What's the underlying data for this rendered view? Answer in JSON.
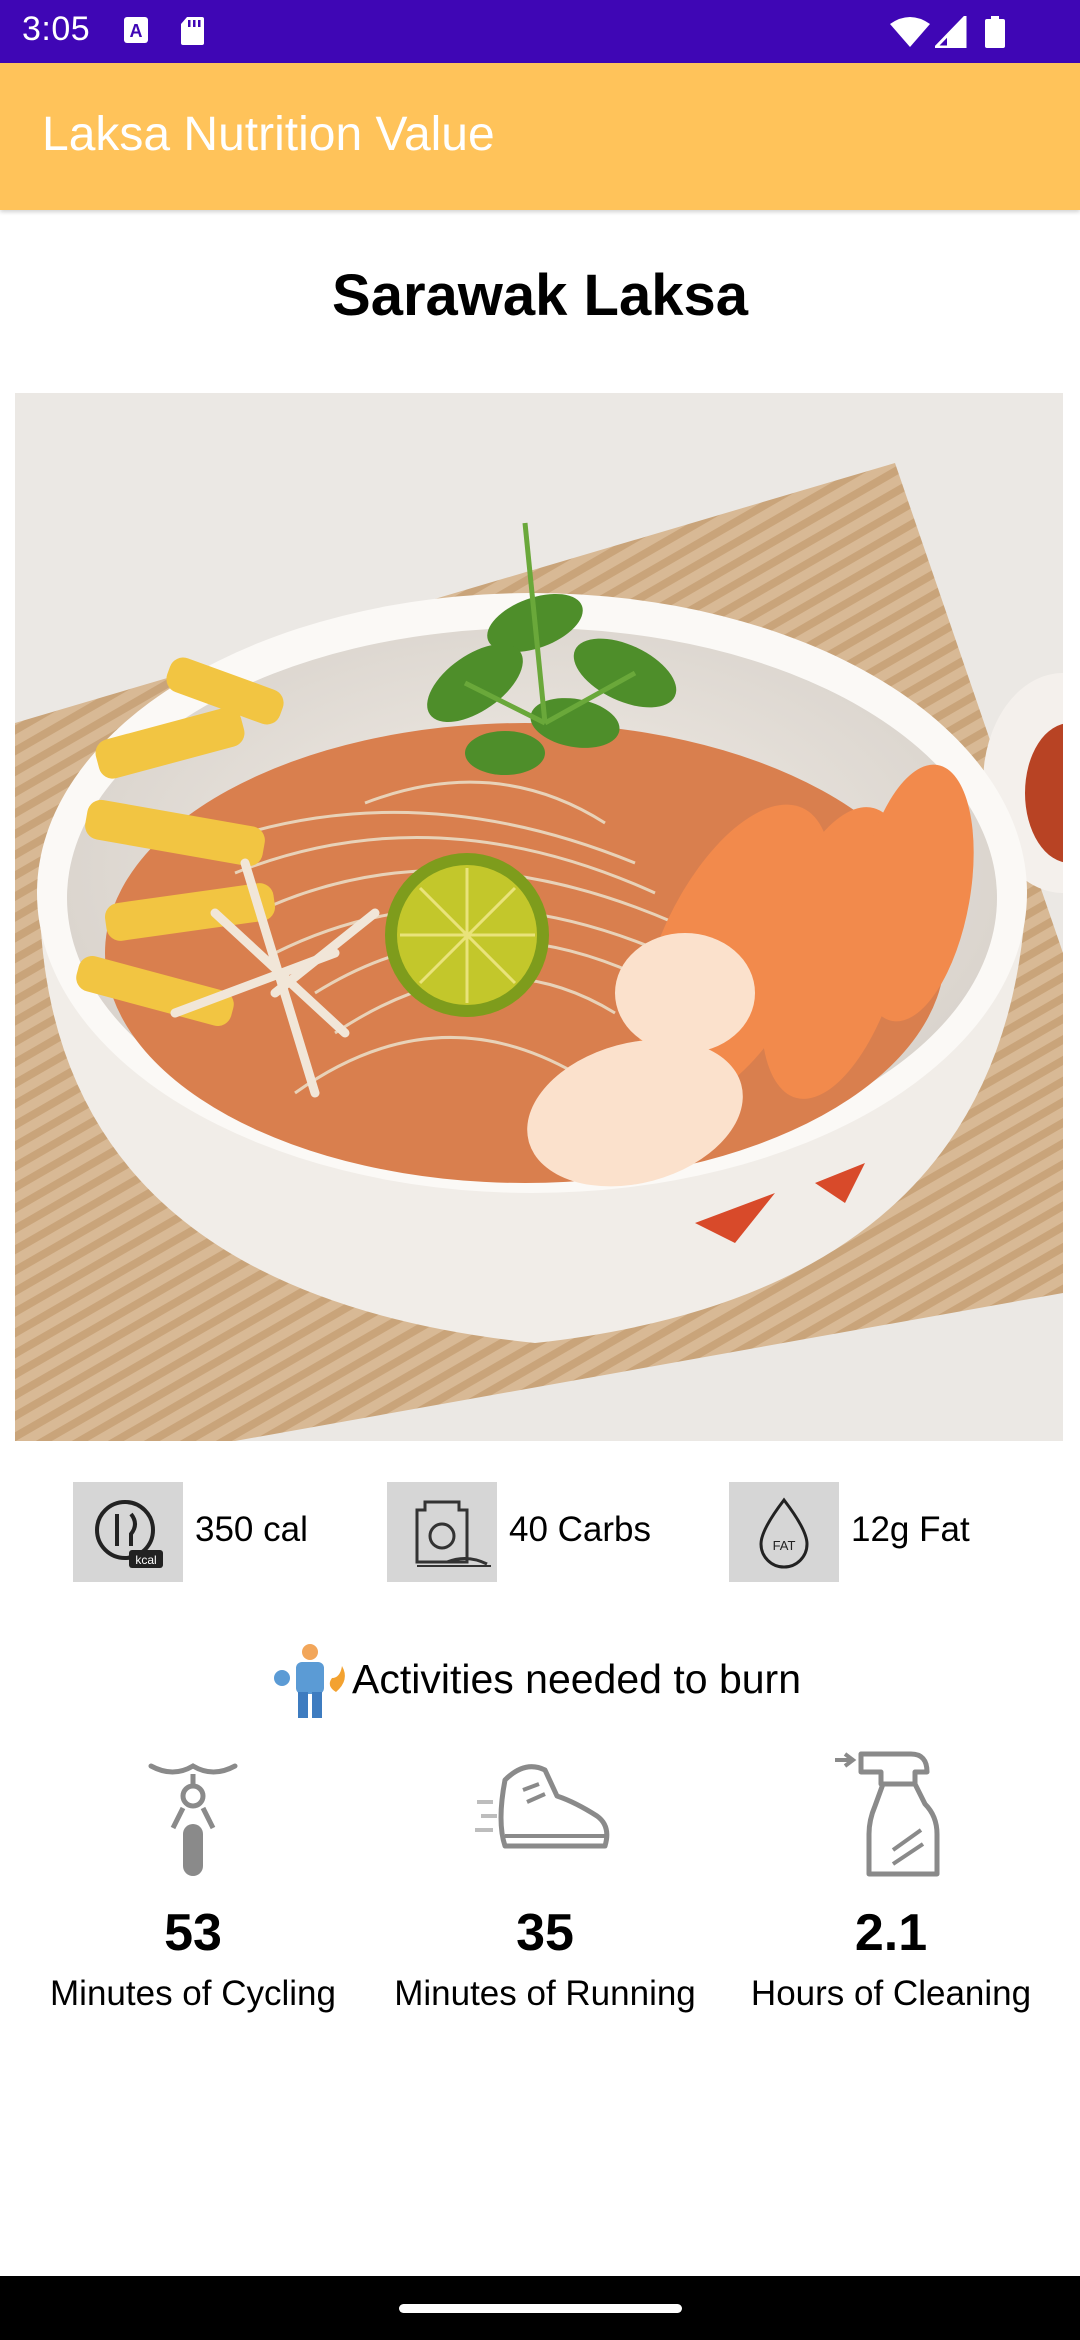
{
  "status_bar": {
    "time": "3:05",
    "left_icons": [
      "a-letter-icon",
      "sd-card-icon"
    ],
    "right_icons": [
      "wifi-icon",
      "cellular-signal-icon",
      "battery-icon"
    ]
  },
  "app_bar": {
    "title": "Laksa Nutrition Value",
    "color": "#ffc35a"
  },
  "dish": {
    "title": "Sarawak Laksa",
    "photo": "laksa-bowl-photo"
  },
  "nutrition": [
    {
      "icon": "calorie-icon",
      "value": "350 cal"
    },
    {
      "icon": "carbs-icon",
      "value": "40 Carbs"
    },
    {
      "icon": "fat-icon",
      "value": "12g Fat"
    }
  ],
  "activities": {
    "heading": "Activities needed to burn",
    "heading_icon": "fitness-burn-icon",
    "items": [
      {
        "icon": "bicycle-icon",
        "value": "53",
        "label": "Minutes of Cycling"
      },
      {
        "icon": "running-shoe-icon",
        "value": "35",
        "label": "Minutes of Running"
      },
      {
        "icon": "spray-bottle-icon",
        "value": "2.1",
        "label": "Hours of Cleaning"
      }
    ]
  },
  "colors": {
    "status_bar": "#3f06b5",
    "app_bar": "#ffc35a",
    "icon_box": "#d6d6d6"
  }
}
